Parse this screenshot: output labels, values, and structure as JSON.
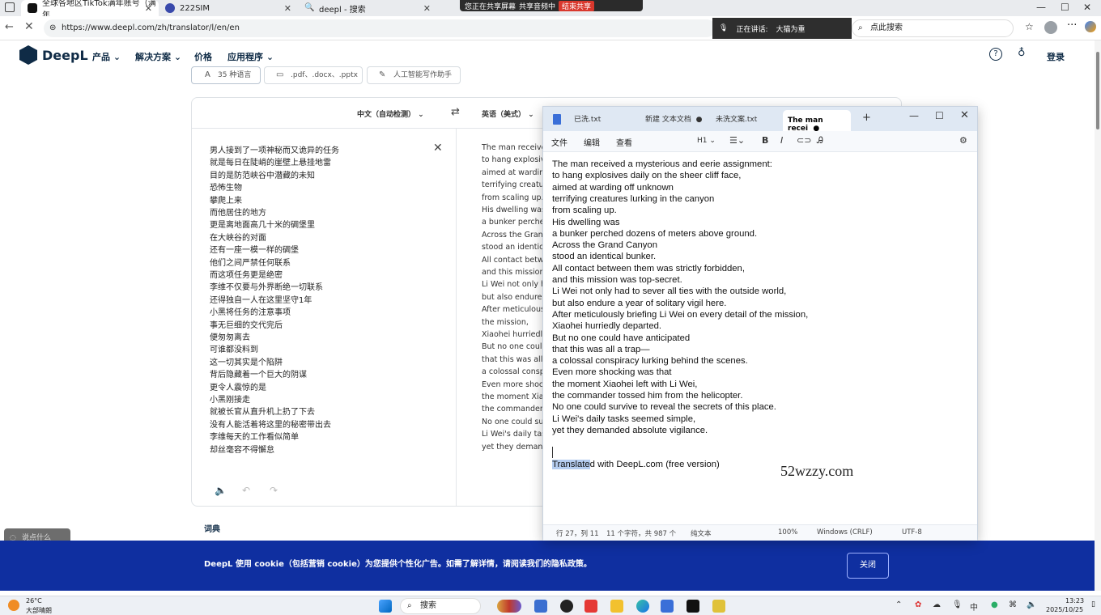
{
  "browser": {
    "tabs": [
      {
        "title": "全球各地区TikTok满年账号（满年",
        "color": "#111111"
      },
      {
        "title": "222SIM",
        "color": "#3949ab"
      },
      {
        "title": "deepl - 搜索",
        "color": "#1a73e8"
      }
    ],
    "url": "https://www.deepl.com/zh/translator/l/en/en",
    "share_status": "您正在共享屏幕",
    "share_audio": "共享音频中",
    "share_stop": "结束共享",
    "voice_label": "正在讲话:",
    "voice_speaker": "大猫为重",
    "search_placeholder": "点此搜索"
  },
  "deepl": {
    "brand": "DeepL",
    "nav": [
      "产品",
      "解决方案",
      "价格",
      "应用程序"
    ],
    "login": "登录",
    "chips": [
      "35 种语言",
      ".pdf、.docx、.pptx",
      "人工智能写作助手"
    ],
    "source_lang": "中文（自动检测）",
    "target_lang": "英语（美式）",
    "source_lines": [
      "男人接到了一项神秘而又诡异的任务",
      "就是每日在陡峭的崖壁上悬挂地雷",
      "目的是防范峡谷中潜藏的未知",
      "恐怖生物",
      "攀爬上来",
      "而他居住的地方",
      "更是离地面高几十米的碉堡里",
      "在大峡谷的对面",
      "还有一座一模一样的碉堡",
      "他们之间严禁任何联系",
      "而这项任务更是绝密",
      "李维不仅要与外界断绝一切联系",
      "还得独自一人在这里坚守1年",
      "小黑将任务的注意事项",
      "事无巨细的交代完后",
      "便匆匆离去",
      "可谁都没料到",
      "这一切其实是个陷阱",
      "背后隐藏着一个巨大的阴谋",
      "更令人震惊的是",
      "小黑刚接走",
      "就被长官从直升机上扔了下去",
      "没有人能活着将这里的秘密带出去",
      "李维每天的工作看似简单",
      "却丝毫容不得懈怠"
    ],
    "target_lines": [
      "The man receive",
      "to hang explosiv",
      "aimed at wardin",
      "terrifying creatur",
      "from scaling up.",
      "His dwelling was",
      "a bunker perche",
      "Across the Gran",
      "stood an identic",
      "All contact betw",
      "and this mission",
      "Li Wei not only h",
      "but also endure a",
      "After meticulous",
      "the mission,",
      "Xiaohei hurriedly",
      "But no one coul",
      "that this was all",
      "a colossal consp",
      "Even more shoc",
      "the moment Xia",
      "the commander",
      "No one could su",
      "Li Wei's daily tas",
      "yet they demand"
    ],
    "dictionary": "词典",
    "ghost_button": "说点什么",
    "cookie_text": "DeepL 使用 cookie（包括营销 cookie）为您提供个性化广告。如需了解详情，请阅读我们的隐私政策。",
    "cookie_close": "关闭"
  },
  "notepad": {
    "tabs": [
      "已洗.txt",
      "新建 文本文档",
      "未洗文案.txt",
      "The man recei"
    ],
    "menu": [
      "文件",
      "编辑",
      "查看"
    ],
    "heading": "H1",
    "lines": [
      "The man received a mysterious and eerie assignment:",
      "to hang explosives daily on the sheer cliff face,",
      "aimed at warding off unknown",
      "terrifying creatures lurking in the canyon",
      "from scaling up.",
      "His dwelling was",
      "a bunker perched dozens of meters above ground.",
      "Across the Grand Canyon",
      "stood an identical bunker.",
      "All contact between them was strictly forbidden,",
      "and this mission was top-secret.",
      "Li Wei not only had to sever all ties with the outside world,",
      "but also endure a year of solitary vigil here.",
      "After meticulously briefing Li Wei on every detail of the mission,",
      "Xiaohei hurriedly departed.",
      "But no one could have anticipated",
      "that this was all a trap—",
      "a colossal conspiracy lurking behind the scenes.",
      "Even more shocking was that",
      "the moment Xiaohei left with Li Wei,",
      "the commander tossed him from the helicopter.",
      "No one could survive to reveal the secrets of this place.",
      "Li Wei's daily tasks seemed simple,",
      "yet they demanded absolute vigilance."
    ],
    "footer_selected": "Translate",
    "footer_rest": "d with DeepL.com (free version)",
    "status": {
      "position": "行 27，列 11",
      "chars": "11 个字符，共 987 个",
      "format": "纯文本",
      "zoom": "100%",
      "eol": "Windows (CRLF)",
      "encoding": "UTF-8"
    }
  },
  "watermark": "52wzzy.com",
  "taskbar": {
    "weather_temp": "26°C",
    "weather_desc": "大部晴朗",
    "search": "搜索",
    "time": "13:23",
    "date": "2025/10/25",
    "ime": "中"
  }
}
